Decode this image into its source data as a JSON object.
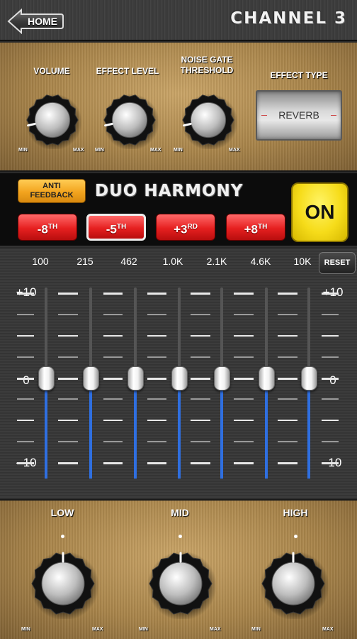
{
  "header": {
    "home_label": "HOME",
    "title": "CHANNEL 3"
  },
  "top_controls": {
    "knobs": [
      {
        "label": "VOLUME",
        "min": "MIN",
        "max": "MAX",
        "level": 0.12
      },
      {
        "label": "EFFECT LEVEL",
        "min": "MIN",
        "max": "MAX",
        "level": 0.12
      },
      {
        "label_line1": "NOISE GATE",
        "label_line2": "THRESHOLD",
        "min": "MIN",
        "max": "MAX",
        "level": 0.12
      }
    ],
    "effect_type": {
      "label": "EFFECT TYPE",
      "value": "REVERB"
    }
  },
  "harmony": {
    "anti_feedback_line1": "ANTI",
    "anti_feedback_line2": "FEEDBACK",
    "title": "DUO HARMONY",
    "on_label": "ON",
    "intervals": [
      {
        "sign": "-8",
        "suffix": "TH",
        "selected": false
      },
      {
        "sign": "-5",
        "suffix": "TH",
        "selected": true
      },
      {
        "sign": "+3",
        "suffix": "RD",
        "selected": false
      },
      {
        "sign": "+8",
        "suffix": "TH",
        "selected": false
      }
    ],
    "colors": {
      "interval": "#e62020",
      "on": "#f6dc1a",
      "anti": "#f2a41e"
    }
  },
  "eq": {
    "reset_label": "RESET",
    "frequencies": [
      "100",
      "215",
      "462",
      "1.0K",
      "2.1K",
      "4.6K",
      "10K"
    ],
    "scale_top": "+10",
    "scale_mid": "0",
    "scale_bottom": "- 10",
    "scale_right_top": "+10",
    "scale_right_mid": "0",
    "scale_right_bottom": "-10",
    "band_values_db": [
      0,
      0,
      0,
      0,
      0,
      0,
      0
    ],
    "fill_color": "#2f6fe0"
  },
  "tone": {
    "knobs": [
      {
        "label": "LOW",
        "min": "MIN",
        "max": "MAX",
        "level": 0.5
      },
      {
        "label": "MID",
        "min": "MIN",
        "max": "MAX",
        "level": 0.5
      },
      {
        "label": "HIGH",
        "min": "MIN",
        "max": "MAX",
        "level": 0.5
      }
    ]
  }
}
